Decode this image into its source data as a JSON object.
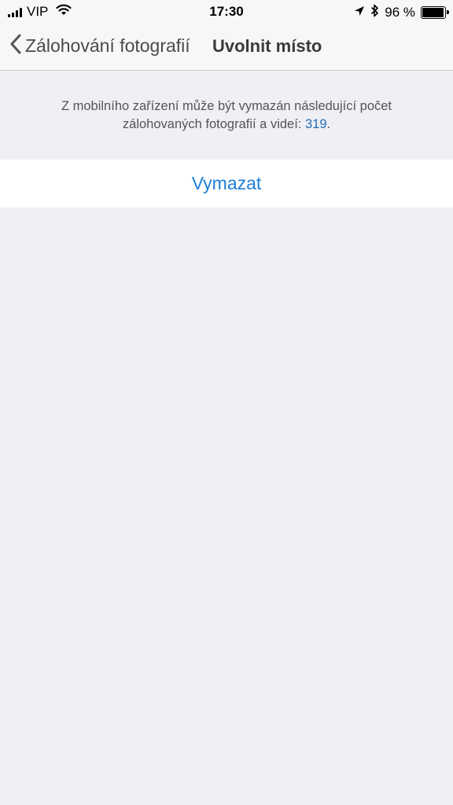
{
  "status_bar": {
    "carrier": "VIP",
    "time": "17:30",
    "battery": "96 %",
    "battery_level": 0.96
  },
  "nav": {
    "back_label": "Zálohování fotografií",
    "title": "Uvolnit místo"
  },
  "info": {
    "text_prefix": "Z mobilního zařízení může být vymazán následující počet zálohovaných fotografií a videí: ",
    "count": "319",
    "text_suffix": "."
  },
  "action": {
    "label": "Vymazat"
  },
  "colors": {
    "accent": "#1e7fd6",
    "background": "#efeff4"
  }
}
